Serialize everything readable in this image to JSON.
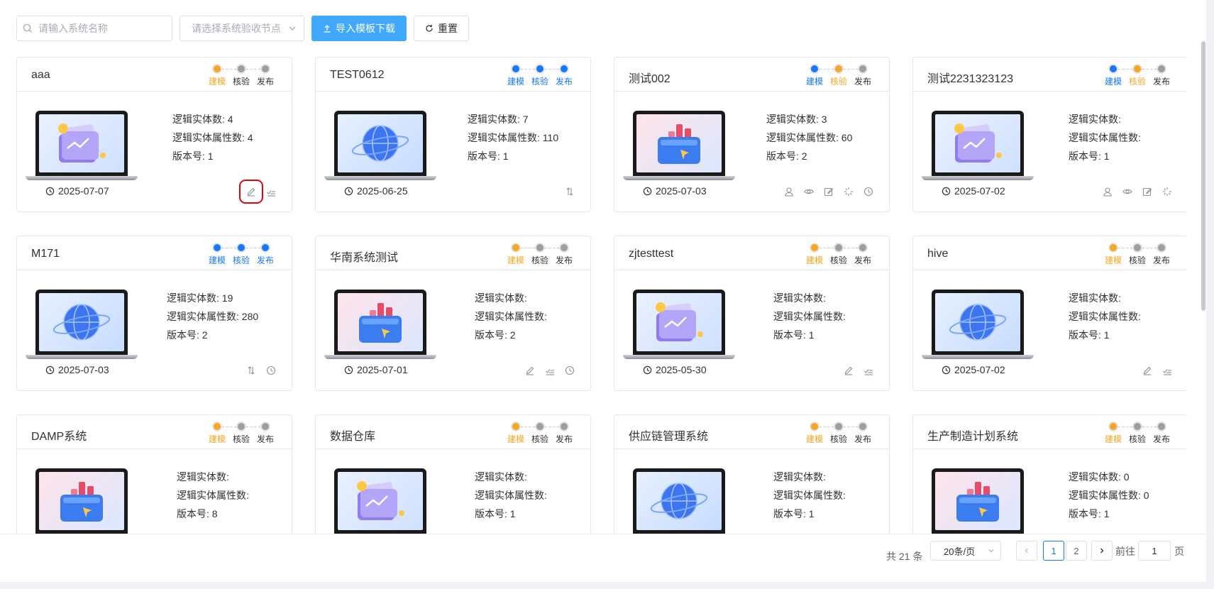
{
  "toolbar": {
    "search_placeholder": "请输入系统名称",
    "select_placeholder": "请选择系统验收节点",
    "import_label": "导入模板下载",
    "reset_label": "重置"
  },
  "labels": {
    "entity_count": "逻辑实体数:",
    "attr_count": "逻辑实体属性数:",
    "version": "版本号:"
  },
  "cards": [
    {
      "title": "aaa",
      "steps": [
        {
          "label": "建模",
          "state": "active"
        },
        {
          "label": "核验",
          "state": "wait"
        },
        {
          "label": "发布",
          "state": "wait"
        }
      ],
      "image": "chart-image",
      "entities": "4",
      "attrs": "4",
      "version": "1",
      "date": "2025-07-07",
      "actions": [
        "edit-icon",
        "check-list-icon"
      ],
      "highlight": 0
    },
    {
      "title": "TEST0612",
      "steps": [
        {
          "label": "建模",
          "state": "done"
        },
        {
          "label": "核验",
          "state": "done"
        },
        {
          "label": "发布",
          "state": "done"
        }
      ],
      "image": "globe-image",
      "entities": "7",
      "attrs": "110",
      "version": "1",
      "date": "2025-06-25",
      "actions": [
        "transfer-icon"
      ]
    },
    {
      "title": "测试002",
      "steps": [
        {
          "label": "建模",
          "state": "done"
        },
        {
          "label": "核验",
          "state": "active"
        },
        {
          "label": "发布",
          "state": "wait"
        }
      ],
      "image": "folder-image",
      "entities": "3",
      "attrs": "60",
      "version": "2",
      "date": "2025-07-03",
      "actions": [
        "user-icon",
        "view-icon",
        "edit-box-icon",
        "loading-icon",
        "clock-icon"
      ]
    },
    {
      "title": "测试2231323123",
      "steps": [
        {
          "label": "建模",
          "state": "done"
        },
        {
          "label": "核验",
          "state": "active"
        },
        {
          "label": "发布",
          "state": "wait"
        }
      ],
      "image": "chart-image",
      "entities": "",
      "attrs": "",
      "version": "1",
      "date": "2025-07-02",
      "actions": [
        "user-icon",
        "view-icon",
        "edit-box-icon",
        "loading-icon"
      ]
    },
    {
      "title": "M171",
      "steps": [
        {
          "label": "建模",
          "state": "done"
        },
        {
          "label": "核验",
          "state": "done"
        },
        {
          "label": "发布",
          "state": "done"
        }
      ],
      "image": "globe-image",
      "entities": "19",
      "attrs": "280",
      "version": "2",
      "date": "2025-07-03",
      "actions": [
        "transfer-icon",
        "clock-icon"
      ]
    },
    {
      "title": "华南系统测试",
      "steps": [
        {
          "label": "建模",
          "state": "active"
        },
        {
          "label": "核验",
          "state": "wait"
        },
        {
          "label": "发布",
          "state": "wait"
        }
      ],
      "image": "folder-image",
      "entities": "",
      "attrs": "",
      "version": "2",
      "date": "2025-07-01",
      "actions": [
        "edit-icon",
        "check-list-icon",
        "clock-icon"
      ]
    },
    {
      "title": "zjtesttest",
      "steps": [
        {
          "label": "建模",
          "state": "active"
        },
        {
          "label": "核验",
          "state": "wait"
        },
        {
          "label": "发布",
          "state": "wait"
        }
      ],
      "image": "chart-image",
      "entities": "",
      "attrs": "",
      "version": "1",
      "date": "2025-05-30",
      "actions": [
        "edit-icon",
        "check-list-icon"
      ]
    },
    {
      "title": "hive",
      "steps": [
        {
          "label": "建模",
          "state": "active"
        },
        {
          "label": "核验",
          "state": "wait"
        },
        {
          "label": "发布",
          "state": "wait"
        }
      ],
      "image": "globe-image",
      "entities": "",
      "attrs": "",
      "version": "1",
      "date": "2025-07-02",
      "actions": [
        "edit-icon",
        "check-list-icon"
      ]
    },
    {
      "title": "DAMP系统",
      "steps": [
        {
          "label": "建模",
          "state": "active"
        },
        {
          "label": "核验",
          "state": "wait"
        },
        {
          "label": "发布",
          "state": "wait"
        }
      ],
      "image": "folder-image",
      "entities": "",
      "attrs": "",
      "version": "8",
      "date": "",
      "actions": []
    },
    {
      "title": "数据仓库",
      "steps": [
        {
          "label": "建模",
          "state": "active"
        },
        {
          "label": "核验",
          "state": "wait"
        },
        {
          "label": "发布",
          "state": "wait"
        }
      ],
      "image": "chart-image",
      "entities": "",
      "attrs": "",
      "version": "1",
      "date": "",
      "actions": []
    },
    {
      "title": "供应链管理系统",
      "steps": [
        {
          "label": "建模",
          "state": "active"
        },
        {
          "label": "核验",
          "state": "wait"
        },
        {
          "label": "发布",
          "state": "wait"
        }
      ],
      "image": "globe-image",
      "entities": "",
      "attrs": "",
      "version": "1",
      "date": "",
      "actions": []
    },
    {
      "title": "生产制造计划系统",
      "steps": [
        {
          "label": "建模",
          "state": "active"
        },
        {
          "label": "核验",
          "state": "wait"
        },
        {
          "label": "发布",
          "state": "wait"
        }
      ],
      "image": "folder-image",
      "entities": "0",
      "attrs": "0",
      "version": "1",
      "date": "",
      "actions": []
    }
  ],
  "pagination": {
    "total_text": "共 21 条",
    "page_size": "20条/页",
    "pages": [
      "1",
      "2"
    ],
    "current": "1",
    "goto_label": "前往",
    "goto_value": "1",
    "goto_unit": "页"
  },
  "colors": {
    "primary": "#40a9ff",
    "done": "#1677ff",
    "active": "#f5a623",
    "wait": "#9e9e9e",
    "highlight": "#e8000b"
  }
}
